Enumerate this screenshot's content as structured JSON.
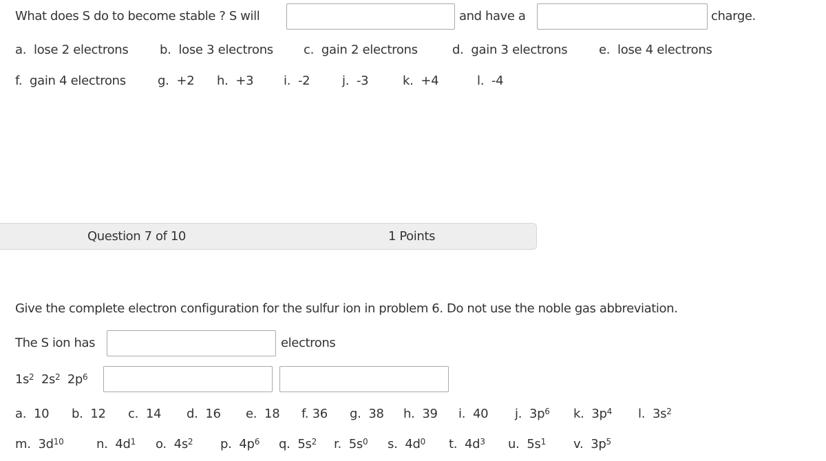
{
  "q6": {
    "prompt": "What does S do to become stable ?  S will",
    "middle": "and have a",
    "end": "charge.",
    "answer1": "",
    "answer2": "",
    "options_row1": [
      {
        "letter": "a.",
        "text": "lose 2 electrons"
      },
      {
        "letter": "b.",
        "text": "lose 3 electrons"
      },
      {
        "letter": "c.",
        "text": "gain 2 electrons"
      },
      {
        "letter": "d.",
        "text": "gain 3 electrons"
      },
      {
        "letter": "e.",
        "text": "lose 4 electrons"
      }
    ],
    "options_row2": [
      {
        "letter": "f.",
        "text": "gain 4 electrons"
      },
      {
        "letter": "g.",
        "text": "+2"
      },
      {
        "letter": "h.",
        "text": "+3"
      },
      {
        "letter": "i.",
        "text": "-2"
      },
      {
        "letter": "j.",
        "text": "-3"
      },
      {
        "letter": "k.",
        "text": "+4"
      },
      {
        "letter": "l.",
        "text": "-4"
      }
    ]
  },
  "header": {
    "question_label": "Question 7 of 10",
    "points_label": "1 Points"
  },
  "q7": {
    "instructions": "Give the complete electron configuration for the sulfur ion in problem 6.  Do not use the noble gas abbreviation.",
    "ion_prefix": "The S ion has",
    "ion_suffix": "electrons",
    "ion_answer": "",
    "config_prefix": [
      {
        "base": "1s",
        "sup": "2"
      },
      {
        "base": "2s",
        "sup": "2"
      },
      {
        "base": "2p",
        "sup": "6"
      }
    ],
    "config_answer1": "",
    "config_answer2": "",
    "options_row1": [
      {
        "letter": "a.",
        "base": "10",
        "sup": ""
      },
      {
        "letter": "b.",
        "base": "12",
        "sup": ""
      },
      {
        "letter": "c.",
        "base": "14",
        "sup": ""
      },
      {
        "letter": "d.",
        "base": "16",
        "sup": ""
      },
      {
        "letter": "e.",
        "base": "18",
        "sup": ""
      },
      {
        "letter": "f.",
        "base": "36",
        "sup": ""
      },
      {
        "letter": "g.",
        "base": "38",
        "sup": ""
      },
      {
        "letter": "h.",
        "base": "39",
        "sup": ""
      },
      {
        "letter": "i.",
        "base": "40",
        "sup": ""
      },
      {
        "letter": "j.",
        "base": "3p",
        "sup": "6"
      },
      {
        "letter": "k.",
        "base": "3p",
        "sup": "4"
      },
      {
        "letter": "l.",
        "base": "3s",
        "sup": "2"
      }
    ],
    "options_row2": [
      {
        "letter": "m.",
        "base": "3d",
        "sup": "10"
      },
      {
        "letter": "n.",
        "base": "4d",
        "sup": "1"
      },
      {
        "letter": "o.",
        "base": "4s",
        "sup": "2"
      },
      {
        "letter": "p.",
        "base": "4p",
        "sup": "6"
      },
      {
        "letter": "q.",
        "base": "5s",
        "sup": "2"
      },
      {
        "letter": "r.",
        "base": "5s",
        "sup": "0"
      },
      {
        "letter": "s.",
        "base": "4d",
        "sup": "0"
      },
      {
        "letter": "t.",
        "base": "4d",
        "sup": "3"
      },
      {
        "letter": "u.",
        "base": "5s",
        "sup": "1"
      },
      {
        "letter": "v.",
        "base": "3p",
        "sup": "5"
      }
    ]
  }
}
